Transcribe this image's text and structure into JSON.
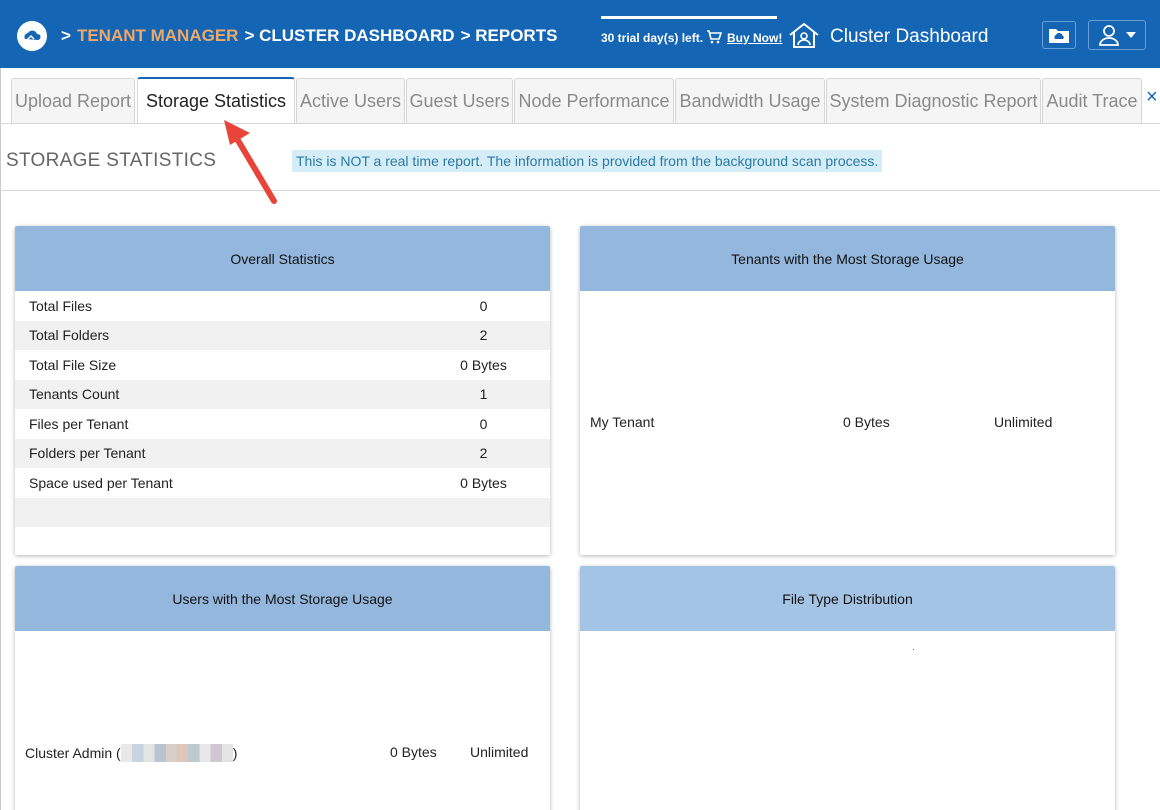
{
  "header": {
    "breadcrumb_prefix": ">",
    "tenant_manager": "TENANT MANAGER",
    "cluster_dashboard": "> CLUSTER DASHBOARD",
    "reports": "> REPORTS",
    "trial_text": "30 trial day(s) left.",
    "buy_now": "Buy Now!",
    "page_title": "Cluster Dashboard",
    "icons": [
      "cloud-logo-icon",
      "cart-icon",
      "home-icon",
      "folder-icon",
      "user-icon",
      "chevron-down-icon"
    ]
  },
  "tabs": [
    {
      "label": "Upload Report"
    },
    {
      "label": "Storage Statistics",
      "active": true
    },
    {
      "label": "Active Users"
    },
    {
      "label": "Guest Users"
    },
    {
      "label": "Node Performance"
    },
    {
      "label": "Bandwidth Usage"
    },
    {
      "label": "System Diagnostic Report"
    },
    {
      "label": "Audit Trace"
    }
  ],
  "tab_close": "×",
  "section": {
    "title": "STORAGE STATISTICS",
    "notice": "This is NOT a real time report. The information is provided from the background scan process."
  },
  "overall": {
    "title": "Overall Statistics",
    "rows": [
      {
        "label": "Total Files",
        "value": "0"
      },
      {
        "label": "Total Folders",
        "value": "2"
      },
      {
        "label": "Total File Size",
        "value": "0 Bytes"
      },
      {
        "label": "Tenants Count",
        "value": "1"
      },
      {
        "label": "Files per Tenant",
        "value": "0"
      },
      {
        "label": "Folders per Tenant",
        "value": "2"
      },
      {
        "label": "Space used per Tenant",
        "value": "0 Bytes"
      }
    ]
  },
  "tenants": {
    "title": "Tenants with the Most Storage Usage",
    "row": {
      "name": "My Tenant",
      "used": "0 Bytes",
      "quota": "Unlimited"
    }
  },
  "users": {
    "title": "Users with the Most Storage Usage",
    "row": {
      "name_prefix": "Cluster Admin (",
      "name_suffix": ")",
      "used": "0 Bytes",
      "quota": "Unlimited"
    }
  },
  "filetypes": {
    "title": "File Type Distribution",
    "dot": "."
  },
  "colors": {
    "header_bg": "#1565b5",
    "accent_orange": "#f0a868",
    "card_header": "#94b8dd",
    "notice_bg": "#d5edf7",
    "arrow": "#e8443a"
  }
}
